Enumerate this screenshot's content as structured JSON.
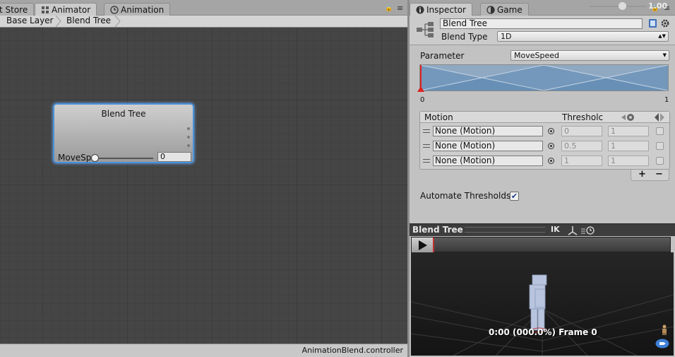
{
  "left_tabs": [
    {
      "label": "t Store",
      "icon": "store-icon"
    },
    {
      "label": "Animator",
      "icon": "animator-icon",
      "active": true
    },
    {
      "label": "Animation",
      "icon": "clock-icon"
    }
  ],
  "right_tabs": [
    {
      "label": "Inspector",
      "icon": "info-icon",
      "active": true
    },
    {
      "label": "Game",
      "icon": "game-icon"
    }
  ],
  "breadcrumb": [
    "Base Layer",
    "Blend Tree"
  ],
  "node": {
    "title": "Blend Tree",
    "param_label": "MoveSp",
    "param_value": "0"
  },
  "status_file": "AnimationBlend.controller",
  "inspector": {
    "name": "Blend Tree",
    "blend_type_label": "Blend Type",
    "blend_type_value": "1D",
    "parameter_label": "Parameter",
    "parameter_value": "MoveSpeed",
    "graph_min": "0",
    "graph_max": "1",
    "columns": {
      "motion": "Motion",
      "threshold": "Thresholc"
    },
    "motions": [
      {
        "motion": "None (Motion)",
        "threshold": "0",
        "speed": "1"
      },
      {
        "motion": "None (Motion)",
        "threshold": "0.5",
        "speed": "1"
      },
      {
        "motion": "None (Motion)",
        "threshold": "1",
        "speed": "1"
      }
    ],
    "add_label": "+",
    "remove_label": "−",
    "automate_label": "Automate Thresholds",
    "automate_checked": "✔"
  },
  "preview": {
    "title": "Blend Tree",
    "ik": "IK",
    "speed": "1.00",
    "time_text": "0:00 (000.0%) Frame 0"
  },
  "colors": {
    "graph_bg": "#454545",
    "node_highlight": "#4a90d9",
    "blend_graph": "#6e93b8",
    "timeline_marker": "#c23030"
  }
}
